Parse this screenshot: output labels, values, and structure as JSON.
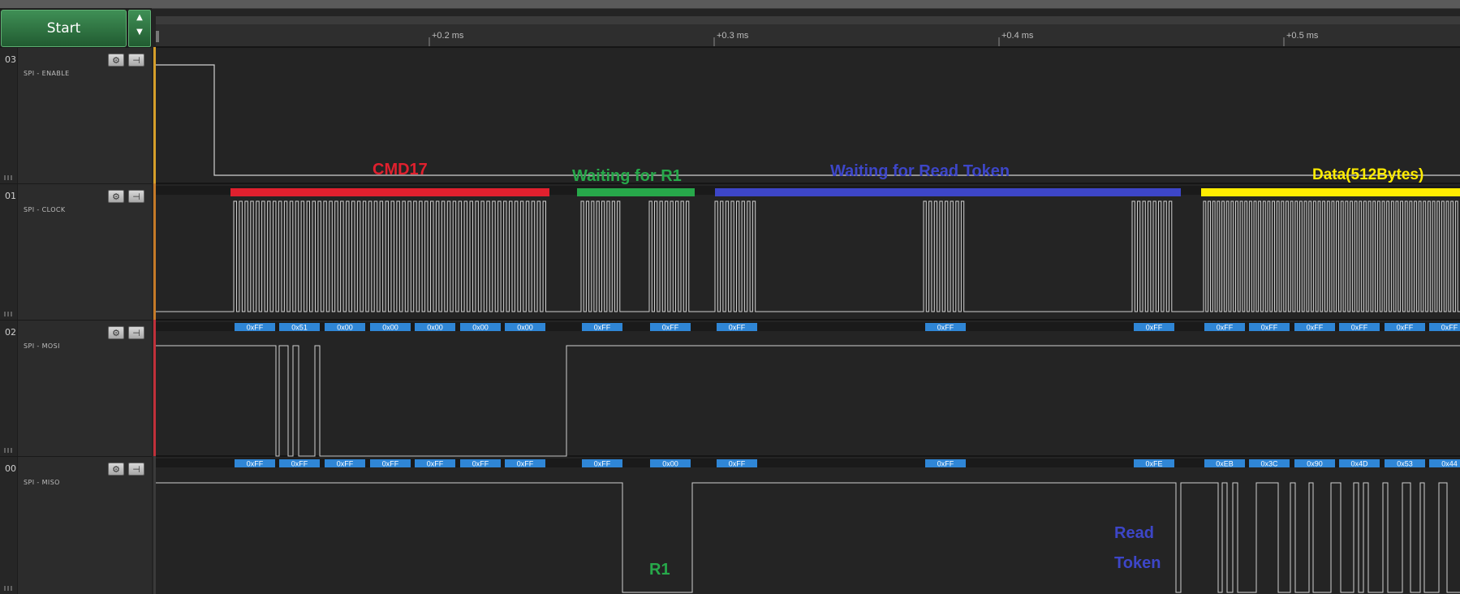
{
  "toolbar": {
    "start_label": "Start"
  },
  "timeline": {
    "ticks": [
      "+0.2 ms",
      "+0.3 ms",
      "+0.4 ms",
      "+0.5 ms"
    ]
  },
  "channels": [
    {
      "num": "03",
      "name": "SPI - ENABLE",
      "color": "#d59e2a"
    },
    {
      "num": "01",
      "name": "SPI - CLOCK",
      "color": "#c57a28"
    },
    {
      "num": "02",
      "name": "SPI - MOSI",
      "color": "#c0303a"
    },
    {
      "num": "00",
      "name": "SPI - MISO",
      "color": "#8a8a8a"
    }
  ],
  "phases": [
    {
      "label": "CMD17",
      "color": "#e0202e"
    },
    {
      "label": "Waiting for R1",
      "color": "#27a84a"
    },
    {
      "label": "Waiting for Read Token",
      "color": "#3d46c8"
    },
    {
      "label": "Data(512Bytes)",
      "color": "#ffec00"
    }
  ],
  "mosi_bytes": [
    "0xFF",
    "0x51",
    "0x00",
    "0x00",
    "0x00",
    "0x00",
    "0x00",
    "0xFF",
    "0xFF",
    "0xFF",
    "0xFF",
    "0xFF",
    "0xFF",
    "0xFF",
    "0xFF",
    "0xFF",
    "0xFF",
    "0xFF"
  ],
  "miso_bytes": [
    "0xFF",
    "0xFF",
    "0xFF",
    "0xFF",
    "0xFF",
    "0xFF",
    "0xFF",
    "0xFF",
    "0x00",
    "0xFF",
    "0xFF",
    "0xFE",
    "0xEB",
    "0x3C",
    "0x90",
    "0x4D",
    "0x53",
    "0x44"
  ],
  "annotations": {
    "r1": "R1",
    "read_token_line1": "Read",
    "read_token_line2": "Token"
  }
}
